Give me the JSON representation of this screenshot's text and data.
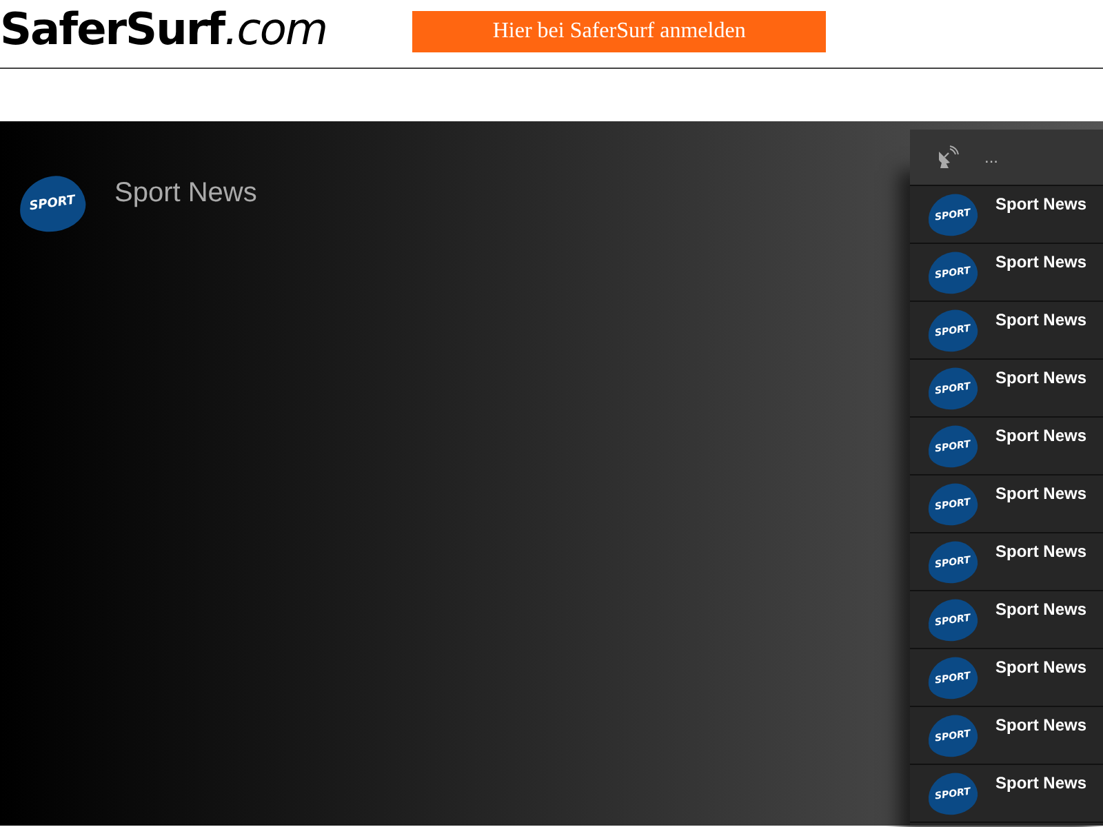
{
  "header": {
    "logo": {
      "name": "SaferSurf",
      "suffix": ".com"
    },
    "signup_button": "Hier bei SaferSurf anmelden"
  },
  "channel": {
    "logo_text": "SPORT",
    "title": "Sport News"
  },
  "sidebar": {
    "header_text": "...",
    "items": [
      {
        "logo_text": "SPORT",
        "title": "Sport News"
      },
      {
        "logo_text": "SPORT",
        "title": "Sport News"
      },
      {
        "logo_text": "SPORT",
        "title": "Sport News"
      },
      {
        "logo_text": "SPORT",
        "title": "Sport News"
      },
      {
        "logo_text": "SPORT",
        "title": "Sport News"
      },
      {
        "logo_text": "SPORT",
        "title": "Sport News"
      },
      {
        "logo_text": "SPORT",
        "title": "Sport News"
      },
      {
        "logo_text": "SPORT",
        "title": "Sport News"
      },
      {
        "logo_text": "SPORT",
        "title": "Sport News"
      },
      {
        "logo_text": "SPORT",
        "title": "Sport News"
      },
      {
        "logo_text": "SPORT",
        "title": "Sport News"
      }
    ]
  }
}
